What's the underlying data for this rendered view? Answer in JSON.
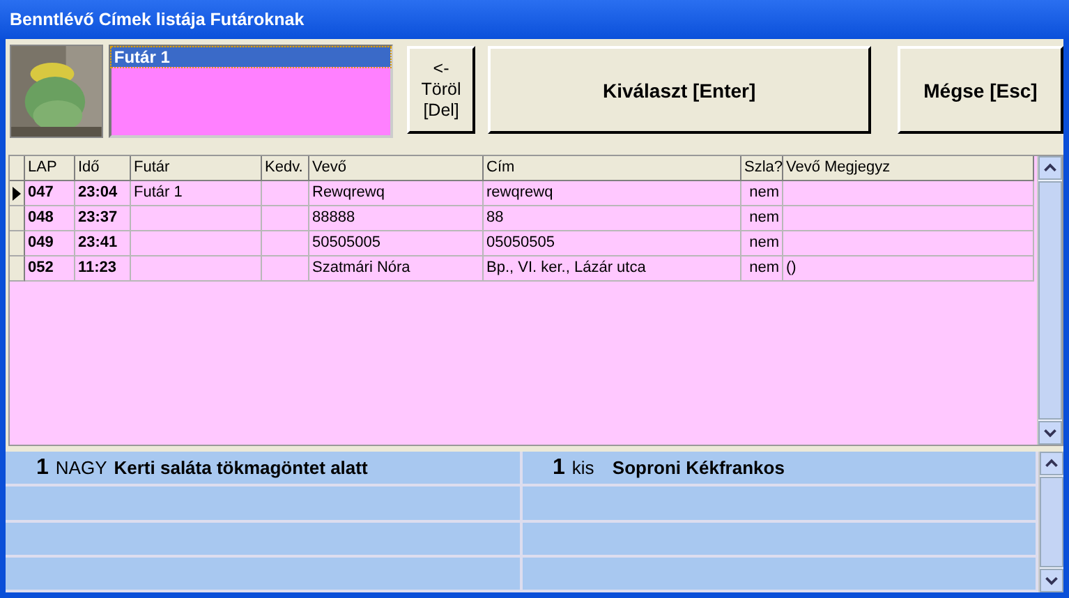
{
  "window": {
    "title": "Benntlévő Címek listája Futároknak"
  },
  "couriers": [
    {
      "label": "Futár 1",
      "selected": true
    }
  ],
  "buttons": [
    {
      "kind": "delete",
      "lines": [
        "<-",
        "Töröl",
        "[Del]"
      ]
    },
    {
      "kind": "select",
      "lines": [
        "Kiválaszt [Enter]"
      ]
    },
    {
      "kind": "cancel",
      "lines": [
        "Mégse [Esc]"
      ]
    }
  ],
  "table": {
    "columns": [
      "LAP",
      "Idő",
      "Futár",
      "Kedv.",
      "Vevő",
      "Cím",
      "Szla?",
      "Vevő Megjegyz"
    ],
    "rows": [
      {
        "selected": true,
        "cells": [
          "047",
          "23:04",
          "Futár 1",
          "",
          "Rewqrewq",
          "rewqrewq",
          "nem",
          ""
        ]
      },
      {
        "selected": false,
        "cells": [
          "048",
          "23:37",
          "",
          "",
          "88888",
          "88",
          "nem",
          ""
        ]
      },
      {
        "selected": false,
        "cells": [
          "049",
          "23:41",
          "",
          "",
          "50505005",
          "05050505",
          "nem",
          ""
        ]
      },
      {
        "selected": false,
        "cells": [
          "052",
          "11:23",
          "",
          "",
          "Szatmári Nóra",
          "Bp., VI. ker., Lázár utca",
          "nem",
          "()"
        ]
      }
    ]
  },
  "items": [
    {
      "qty": "1",
      "size": "NAGY",
      "name": "Kerti saláta tökmagöntet alatt"
    },
    {
      "qty": "1",
      "size": "kis",
      "name": "Soproni Kékfrankos"
    }
  ]
}
